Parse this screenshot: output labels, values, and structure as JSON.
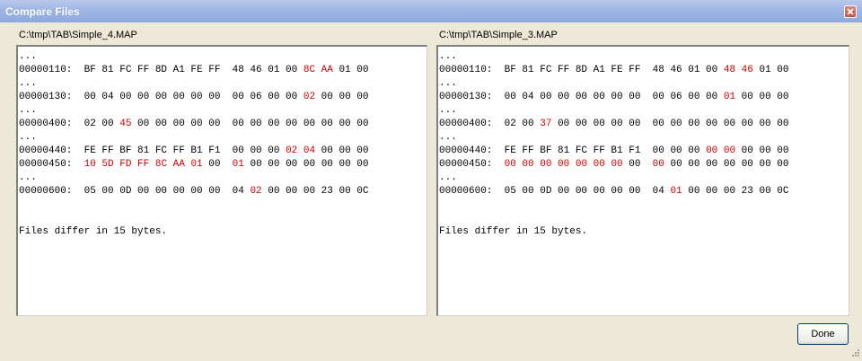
{
  "window": {
    "title": "Compare Files"
  },
  "left": {
    "path": "C:\\tmp\\TAB\\Simple_4.MAP",
    "lines": [
      [
        [
          "...",
          false
        ]
      ],
      [
        [
          "00000110:  BF 81 FC FF 8D A1 FE FF  48 46 01 00 ",
          false
        ],
        [
          "8C AA",
          true
        ],
        [
          " 01 00",
          false
        ]
      ],
      [
        [
          "...",
          false
        ]
      ],
      [
        [
          "00000130:  00 04 00 00 00 00 00 00  00 06 00 00 ",
          false
        ],
        [
          "02",
          true
        ],
        [
          " 00 00 00",
          false
        ]
      ],
      [
        [
          "...",
          false
        ]
      ],
      [
        [
          "00000400:  02 00 ",
          false
        ],
        [
          "45",
          true
        ],
        [
          " 00 00 00 00 00  00 00 00 00 00 00 00 00",
          false
        ]
      ],
      [
        [
          "...",
          false
        ]
      ],
      [
        [
          "00000440:  FE FF BF 81 FC FF B1 F1  00 00 00 ",
          false
        ],
        [
          "02 04",
          true
        ],
        [
          " 00 00 00",
          false
        ]
      ],
      [
        [
          "00000450:  ",
          false
        ],
        [
          "10 5D FD FF 8C AA 01",
          true
        ],
        [
          " 00  ",
          false
        ],
        [
          "01",
          true
        ],
        [
          " 00 00 00 00 00 00 00",
          false
        ]
      ],
      [
        [
          "...",
          false
        ]
      ],
      [
        [
          "00000600:  05 00 0D 00 00 00 00 00  04 ",
          false
        ],
        [
          "02",
          true
        ],
        [
          " 00 00 00 23 00 0C",
          false
        ]
      ]
    ],
    "summary": "Files differ in 15 bytes."
  },
  "right": {
    "path": "C:\\tmp\\TAB\\Simple_3.MAP",
    "lines": [
      [
        [
          "...",
          false
        ]
      ],
      [
        [
          "00000110:  BF 81 FC FF 8D A1 FE FF  48 46 01 00 ",
          false
        ],
        [
          "48 46",
          true
        ],
        [
          " 01 00",
          false
        ]
      ],
      [
        [
          "...",
          false
        ]
      ],
      [
        [
          "00000130:  00 04 00 00 00 00 00 00  00 06 00 00 ",
          false
        ],
        [
          "01",
          true
        ],
        [
          " 00 00 00",
          false
        ]
      ],
      [
        [
          "...",
          false
        ]
      ],
      [
        [
          "00000400:  02 00 ",
          false
        ],
        [
          "37",
          true
        ],
        [
          " 00 00 00 00 00  00 00 00 00 00 00 00 00",
          false
        ]
      ],
      [
        [
          "...",
          false
        ]
      ],
      [
        [
          "00000440:  FE FF BF 81 FC FF B1 F1  00 00 00 ",
          false
        ],
        [
          "00 00",
          true
        ],
        [
          " 00 00 00",
          false
        ]
      ],
      [
        [
          "00000450:  ",
          false
        ],
        [
          "00 00 00 00 00 00 00",
          true
        ],
        [
          " 00  ",
          false
        ],
        [
          "00",
          true
        ],
        [
          " 00 00 00 00 00 00 00",
          false
        ]
      ],
      [
        [
          "...",
          false
        ]
      ],
      [
        [
          "00000600:  05 00 0D 00 00 00 00 00  04 ",
          false
        ],
        [
          "01",
          true
        ],
        [
          " 00 00 00 23 00 0C",
          false
        ]
      ]
    ],
    "summary": "Files differ in 15 bytes."
  },
  "buttons": {
    "done": "Done"
  },
  "icons": {
    "close": "close-icon",
    "grip": "resize-grip-icon"
  },
  "colors": {
    "diff": "#d00000",
    "titlebar": "#9eb6e4"
  }
}
